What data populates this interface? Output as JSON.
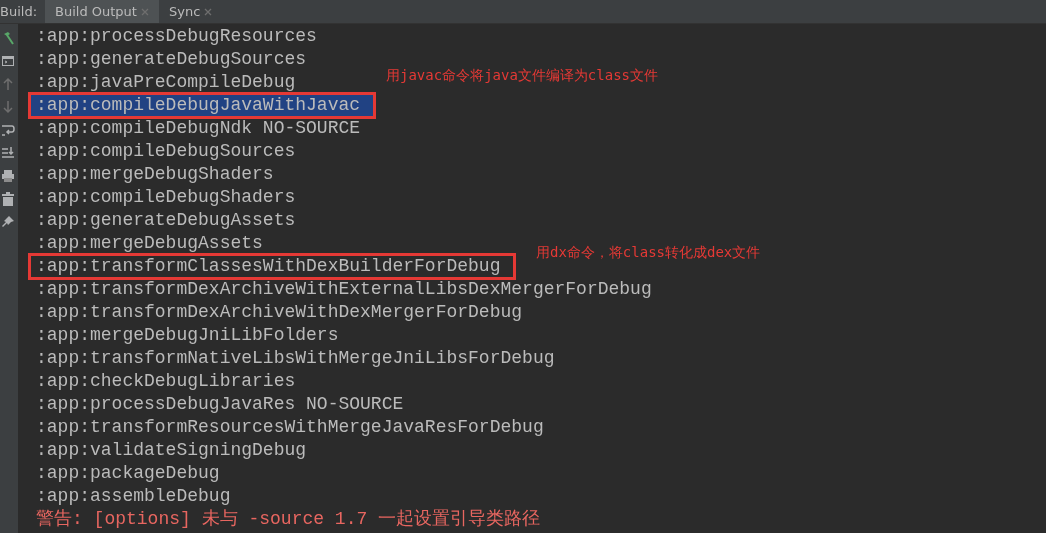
{
  "tabs": {
    "heading": "Build:",
    "items": [
      {
        "label": "Build Output",
        "selected": true
      },
      {
        "label": "Sync",
        "selected": false
      }
    ]
  },
  "toolbar": [
    {
      "kind": "hammer"
    },
    {
      "kind": "console"
    },
    {
      "kind": "up"
    },
    {
      "kind": "down"
    },
    {
      "kind": "wrap"
    },
    {
      "kind": "scroll-end"
    },
    {
      "kind": "print"
    },
    {
      "kind": "trash"
    },
    {
      "kind": "pin"
    }
  ],
  "lines": [
    {
      "kind": "log",
      "text": ":app:processDebugResources",
      "selected": false,
      "boxed": false
    },
    {
      "kind": "log",
      "text": ":app:generateDebugSources",
      "selected": false,
      "boxed": false
    },
    {
      "kind": "log",
      "text": ":app:javaPreCompileDebug",
      "selected": false,
      "boxed": false
    },
    {
      "kind": "log",
      "text": ":app:compileDebugJavaWithJavac",
      "selected": true,
      "boxed": true,
      "annotation": "用javac命令将java文件编译为class文件"
    },
    {
      "kind": "log",
      "text": ":app:compileDebugNdk NO-SOURCE",
      "selected": false,
      "boxed": false
    },
    {
      "kind": "log",
      "text": ":app:compileDebugSources",
      "selected": false,
      "boxed": false
    },
    {
      "kind": "log",
      "text": ":app:mergeDebugShaders",
      "selected": false,
      "boxed": false
    },
    {
      "kind": "log",
      "text": ":app:compileDebugShaders",
      "selected": false,
      "boxed": false
    },
    {
      "kind": "log",
      "text": ":app:generateDebugAssets",
      "selected": false,
      "boxed": false
    },
    {
      "kind": "log",
      "text": ":app:mergeDebugAssets",
      "selected": false,
      "boxed": false
    },
    {
      "kind": "log",
      "text": ":app:transformClassesWithDexBuilderForDebug",
      "selected": false,
      "boxed": true,
      "annotation": "用dx命令，将class转化成dex文件"
    },
    {
      "kind": "log",
      "text": ":app:transformDexArchiveWithExternalLibsDexMergerForDebug",
      "selected": false,
      "boxed": false
    },
    {
      "kind": "log",
      "text": ":app:transformDexArchiveWithDexMergerForDebug",
      "selected": false,
      "boxed": false
    },
    {
      "kind": "log",
      "text": ":app:mergeDebugJniLibFolders",
      "selected": false,
      "boxed": false
    },
    {
      "kind": "log",
      "text": ":app:transformNativeLibsWithMergeJniLibsForDebug",
      "selected": false,
      "boxed": false
    },
    {
      "kind": "log",
      "text": ":app:checkDebugLibraries",
      "selected": false,
      "boxed": false
    },
    {
      "kind": "log",
      "text": ":app:processDebugJavaRes NO-SOURCE",
      "selected": false,
      "boxed": false
    },
    {
      "kind": "log",
      "text": ":app:transformResourcesWithMergeJavaResForDebug",
      "selected": false,
      "boxed": false
    },
    {
      "kind": "log",
      "text": ":app:validateSigningDebug",
      "selected": false,
      "boxed": false
    },
    {
      "kind": "log",
      "text": ":app:packageDebug",
      "selected": false,
      "boxed": false
    },
    {
      "kind": "log",
      "text": ":app:assembleDebug",
      "selected": false,
      "boxed": false
    },
    {
      "kind": "warning",
      "text": "警告: [options] 未与 -source 1.7 一起设置引导类路径",
      "selected": false,
      "boxed": false
    }
  ]
}
